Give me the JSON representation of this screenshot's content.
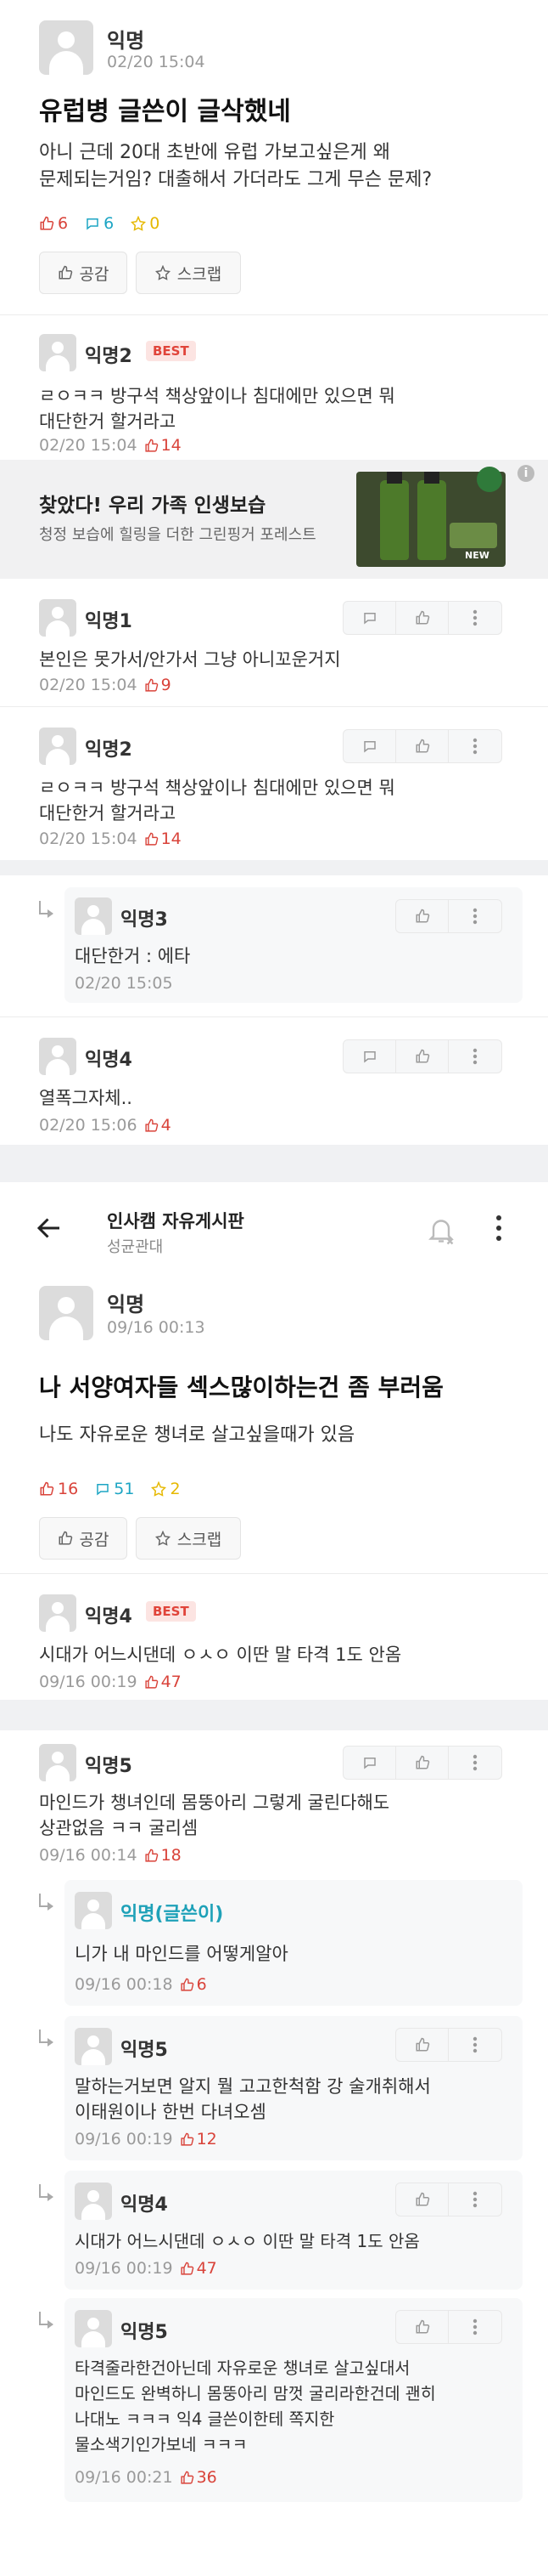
{
  "post1": {
    "author": "익명",
    "time": "02/20 15:04",
    "title": "유럽병 글쓴이 글삭했네",
    "body": "아니 근데 20대 초반에 유럽 가보고싶은게 왜\n문제되는거임? 대출해서 가더라도 그게 무슨 문제?",
    "likes": "6",
    "comments": "6",
    "scraps": "0",
    "like_btn": "공감",
    "scrap_btn": "스크랩"
  },
  "best1": {
    "author": "익명2",
    "badge": "BEST",
    "text": "ㄹㅇㅋㅋ 방구석 책상앞이나 침대에만 있으면 뭐\n대단한거 할거라고",
    "time": "02/20 15:04",
    "likes": "14"
  },
  "ad": {
    "title": "찾았다! 우리 가족 인생보습",
    "sub": "청정 보습에 힐링을 더한 그린핑거 포레스트",
    "tag": "NEW",
    "info": "i"
  },
  "c1": {
    "author": "익명1",
    "text": "본인은 못가서/안가서 그냥 아니꼬운거지",
    "time": "02/20 15:04",
    "likes": "9"
  },
  "c2": {
    "author": "익명2",
    "text": "ㄹㅇㅋㅋ 방구석 책상앞이나 침대에만 있으면 뭐\n대단한거 할거라고",
    "time": "02/20 15:04",
    "likes": "14"
  },
  "r1": {
    "author": "익명3",
    "text": "대단한거 : 에타",
    "time": "02/20 15:05"
  },
  "c3": {
    "author": "익명4",
    "text": "열폭그자체..",
    "time": "02/20 15:06",
    "likes": "4"
  },
  "header": {
    "board": "인사캠 자유게시판",
    "school": "성균관대"
  },
  "post2": {
    "author": "익명",
    "time": "09/16 00:13",
    "title": "나 서양여자들 섹스많이하는건 좀 부러움",
    "body": "나도 자유로운 챙녀로 살고싶을때가 있음",
    "likes": "16",
    "comments": "51",
    "scraps": "2",
    "like_btn": "공감",
    "scrap_btn": "스크랩"
  },
  "best2": {
    "author": "익명4",
    "badge": "BEST",
    "text": "시대가 어느시댄데 ㅇㅅㅇ 이딴 말 타격 1도 안옴",
    "time": "09/16 00:19",
    "likes": "47"
  },
  "c4": {
    "author": "익명5",
    "text": "마인드가 챙녀인데 몸뚱아리 그렇게 굴린다해도\n상관없음 ㅋㅋ 굴리셈",
    "time": "09/16 00:14",
    "likes": "18"
  },
  "r2": {
    "author": "익명(글쓴이)",
    "text": "니가 내 마인드를 어떻게알아",
    "time": "09/16 00:18",
    "likes": "6"
  },
  "r3": {
    "author": "익명5",
    "text": "말하는거보면 알지 뭘 고고한척함 강 술개취해서\n이태원이나 한번 다녀오셈",
    "time": "09/16 00:19",
    "likes": "12"
  },
  "r4": {
    "author": "익명4",
    "text": "시대가 어느시댄데 ㅇㅅㅇ 이딴 말 타격 1도 안옴",
    "time": "09/16 00:19",
    "likes": "47"
  },
  "r5": {
    "author": "익명5",
    "text": "타격줄라한건아닌데 자유로운 챙녀로 살고싶대서\n마인드도 완벽하니 몸뚱아리 맘껏 굴리라한건데 괜히\n나대노 ㅋㅋㅋ 익4 글쓴이한테 쪽지한\n물소색기인가보네 ㅋㅋㅋ",
    "time": "09/16 00:21",
    "likes": "36"
  },
  "colors": {
    "like": "#d9433a",
    "comment": "#1da5c4",
    "scrap": "#e6b800",
    "writer": "#1ea1b8",
    "best_bg": "#fce4e2"
  }
}
